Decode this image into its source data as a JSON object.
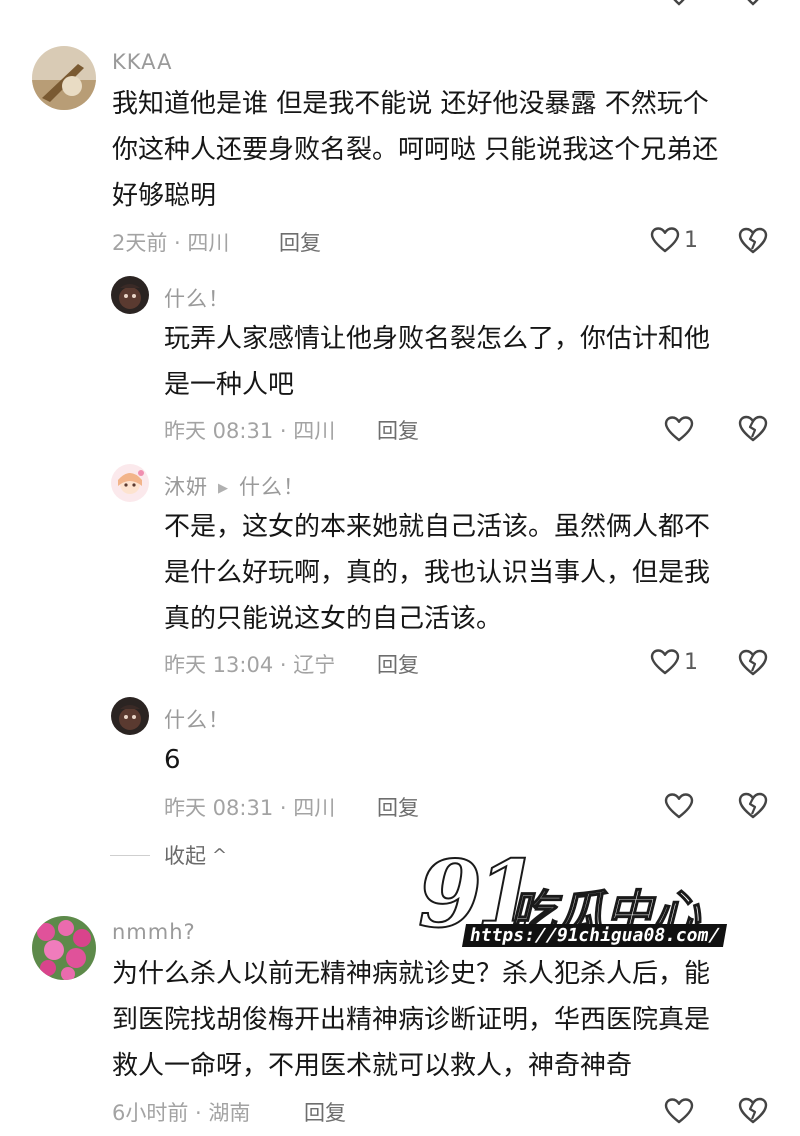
{
  "comments": [
    {
      "username": "KKAA",
      "lines": [
        "我知道他是谁 但是我不能说 还好他没暴露 不然玩个",
        "你这种人还要身败名裂。呵呵哒 只能说我这个兄弟还",
        "好够聪明"
      ],
      "meta": "2天前 · 四川",
      "reply_label": "回复",
      "likes": "1",
      "replies": [
        {
          "username": "什么！",
          "lines": [
            "玩弄人家感情让他身败名裂怎么了，你估计和他",
            "是一种人吧"
          ],
          "meta": "昨天 08:31 · 四川",
          "reply_label": "回复",
          "likes": ""
        },
        {
          "username": "沐妍",
          "reply_to": "什么！",
          "lines": [
            "不是，这女的本来她就自己活该。虽然俩人都不",
            "是什么好玩啊，真的，我也认识当事人，但是我",
            "真的只能说这女的自己活该。"
          ],
          "meta": "昨天 13:04 · 辽宁",
          "reply_label": "回复",
          "likes": "1"
        },
        {
          "username": "什么！",
          "lines": [
            "6"
          ],
          "meta": "昨天 08:31 · 四川",
          "reply_label": "回复",
          "likes": ""
        }
      ],
      "collapse_label": "收起"
    },
    {
      "username": "nmmh?",
      "lines": [
        "为什么杀人以前无精神病就诊史？杀人犯杀人后，能",
        "到医院找胡俊梅开出精神病诊断证明，华西医院真是",
        "救人一命呀，不用医术就可以救人，神奇神奇"
      ],
      "meta": "6小时前 · 湖南",
      "reply_label": "回复",
      "likes": ""
    }
  ],
  "watermark": {
    "number": "91",
    "brand": "吃瓜中心",
    "url": "https://91chigua08.com/"
  },
  "icons": {
    "like": "heart-outline-icon",
    "dislike": "broken-heart-icon",
    "collapse": "chevron-up-icon"
  },
  "colors": {
    "text": "#161616",
    "muted": "#a3a3a3",
    "reply_button": "#6e6e6e",
    "background": "#ffffff"
  }
}
